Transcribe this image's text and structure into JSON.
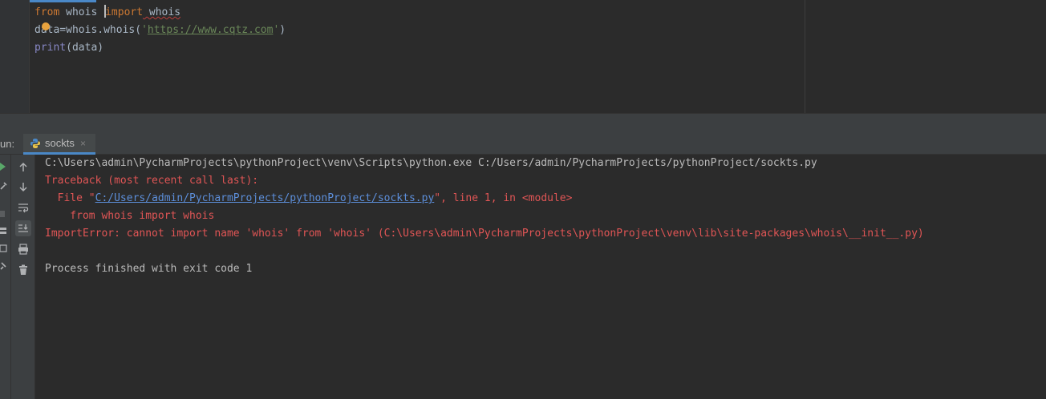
{
  "editor": {
    "lines": [
      {
        "kw1": "from",
        "mod": " whois ",
        "kw2": "import",
        "name": " whois"
      },
      {
        "prefix": "data=whois.whois(",
        "quote_open": "'",
        "url": "https://www.cqtz.com",
        "quote_close": "'",
        "suffix": ")"
      },
      {
        "func": "print",
        "args": "(data)"
      }
    ]
  },
  "run_panel": {
    "label": "un:",
    "tab_label": "sockts",
    "close_glyph": "×",
    "console": {
      "cmd": "C:\\Users\\admin\\PycharmProjects\\pythonProject\\venv\\Scripts\\python.exe C:/Users/admin/PycharmProjects/pythonProject/sockts.py",
      "traceback_header": "Traceback (most recent call last):",
      "file_prefix": "  File \"",
      "file_link": "C:/Users/admin/PycharmProjects/pythonProject/sockts.py",
      "file_suffix": "\", line 1, in <module>",
      "source_line": "    from whois import whois",
      "error": "ImportError: cannot import name 'whois' from 'whois' (C:\\Users\\admin\\PycharmProjects\\pythonProject\\venv\\lib\\site-packages\\whois\\__init__.py)",
      "exit": "Process finished with exit code 1"
    }
  },
  "colors": {
    "background": "#2b2b2b",
    "panel": "#3c3f41",
    "keyword": "#cc7832",
    "string": "#6a8759",
    "error": "#e05555",
    "link": "#5c8ed9",
    "accent": "#4a88c7"
  }
}
